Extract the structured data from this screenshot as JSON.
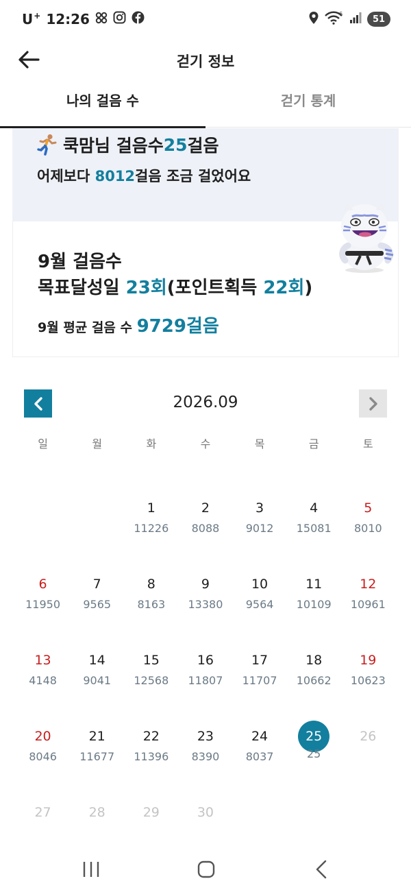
{
  "status_bar": {
    "carrier": "U",
    "carrier_sup": "+",
    "time": "12:26",
    "battery": "51",
    "icons": [
      "pinwheel-icon",
      "instagram-icon",
      "facebook-icon",
      "location-icon",
      "wifi-icon",
      "signal-icon",
      "battery-icon"
    ]
  },
  "header": {
    "title": "걷기 정보",
    "back_icon": "back-arrow-icon"
  },
  "tabs": [
    {
      "label": "나의 걸음 수",
      "active": true
    },
    {
      "label": "걷기 통계",
      "active": false
    }
  ],
  "banner": {
    "name_prefix": "쿡맘님 걸음수 ",
    "today_steps": "25",
    "steps_unit": "걸음",
    "compare_prefix": "어제보다 ",
    "compare_value": "8012",
    "compare_suffix": "걸음 조금 걸었어요"
  },
  "monthly": {
    "line1": "9월 걸음수",
    "goal_prefix": "목표달성일 ",
    "goal_days": "23회",
    "points_prefix": "(포인트획득 ",
    "points_days": "22회",
    "points_suffix": ")",
    "avg_prefix": "9월 평균 걸음 수 ",
    "avg_value": "9729걸음"
  },
  "calendar": {
    "month_label": "2026.09",
    "weekdays": [
      "일",
      "월",
      "화",
      "수",
      "목",
      "금",
      "토"
    ],
    "days": [
      {
        "day": "",
        "steps": ""
      },
      {
        "day": "",
        "steps": ""
      },
      {
        "day": "1",
        "steps": "11226"
      },
      {
        "day": "2",
        "steps": "8088"
      },
      {
        "day": "3",
        "steps": "9012"
      },
      {
        "day": "4",
        "steps": "15081"
      },
      {
        "day": "5",
        "steps": "8010"
      },
      {
        "day": "6",
        "steps": "11950"
      },
      {
        "day": "7",
        "steps": "9565"
      },
      {
        "day": "8",
        "steps": "8163"
      },
      {
        "day": "9",
        "steps": "13380"
      },
      {
        "day": "10",
        "steps": "9564"
      },
      {
        "day": "11",
        "steps": "10109"
      },
      {
        "day": "12",
        "steps": "10961"
      },
      {
        "day": "13",
        "steps": "4148"
      },
      {
        "day": "14",
        "steps": "9041"
      },
      {
        "day": "15",
        "steps": "12568"
      },
      {
        "day": "16",
        "steps": "11807"
      },
      {
        "day": "17",
        "steps": "11707"
      },
      {
        "day": "18",
        "steps": "10662"
      },
      {
        "day": "19",
        "steps": "10623"
      },
      {
        "day": "20",
        "steps": "8046"
      },
      {
        "day": "21",
        "steps": "11677"
      },
      {
        "day": "22",
        "steps": "11396"
      },
      {
        "day": "23",
        "steps": "8390"
      },
      {
        "day": "24",
        "steps": "8037"
      },
      {
        "day": "25",
        "steps": "25"
      },
      {
        "day": "26",
        "steps": ""
      },
      {
        "day": "27",
        "steps": ""
      },
      {
        "day": "28",
        "steps": ""
      },
      {
        "day": "29",
        "steps": ""
      },
      {
        "day": "30",
        "steps": ""
      }
    ],
    "today": "25"
  },
  "colors": {
    "accent": "#137f9e",
    "weekend": "#c81e1e",
    "banner_bg": "#eef1f7"
  }
}
